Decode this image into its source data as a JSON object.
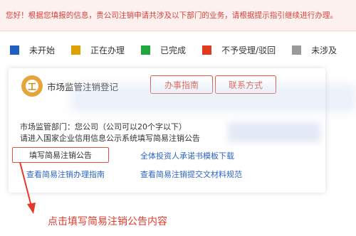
{
  "notice": {
    "text": "您好！根据您填报的信息，贵公司注销申请共涉及以下部门的业务，请根据提示指引继续进行办理。"
  },
  "legend": [
    {
      "label": "未开始",
      "color": "#1f5fc2"
    },
    {
      "label": "正在办理",
      "color": "#e0a000"
    },
    {
      "label": "已完成",
      "color": "#1fa83c"
    },
    {
      "label": "不予受理/驳回",
      "color": "#e03a1e"
    },
    {
      "label": "未涉及",
      "color": "#9a9a9a"
    }
  ],
  "card": {
    "icon_char": "工",
    "title": "市场监管注销登记",
    "guide_button": "办事指南",
    "contact_button": "联系方式",
    "desc_line1": "市场监管部门：您公司（公司可以20个字以下）",
    "desc_line2": "请进入国家企业信用信息公示系统填写简易注销公告",
    "action_button": "填写简易注销公告",
    "links": {
      "commitment_template": "全体投资人承诺书模板下载",
      "process_guide": "查看简易注销办理指南",
      "documents_spec": "查看简易注销提交文材料规范"
    }
  },
  "annotation": {
    "text": "点击填写简易注销公告内容",
    "color": "#e33a2a"
  }
}
